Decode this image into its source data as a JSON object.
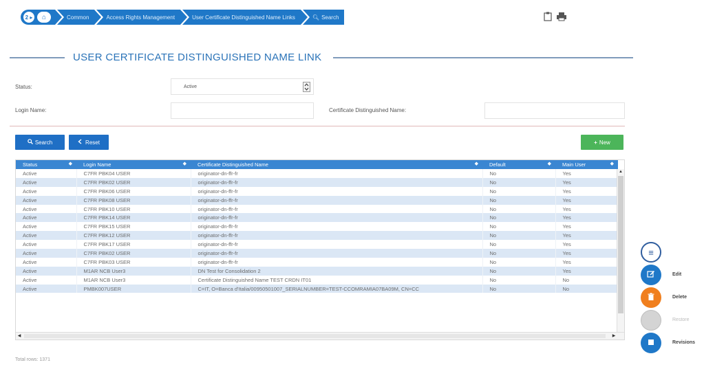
{
  "breadcrumb": {
    "nav_label": "2 ▸",
    "home_icon": "⌂",
    "items": [
      "Common",
      "Access Rights Management",
      "User Certificate Distinguished Name Links",
      "Search"
    ]
  },
  "page": {
    "title": "USER CERTIFICATE DISTINGUISHED NAME LINK"
  },
  "form": {
    "status_label": "Status:",
    "status_value": "Active",
    "login_label": "Login Name:",
    "login_value": "",
    "cert_label": "Certificate Distinguished Name:",
    "cert_value": ""
  },
  "buttons": {
    "search": "Search",
    "reset": "Reset",
    "new": "New"
  },
  "table": {
    "headers": [
      "Status",
      "Login Name",
      "Certificate Distinguished Name",
      "Default",
      "Main User"
    ],
    "rows": [
      [
        "Active",
        "C7FR PBK04 USER",
        "originator-dn-ffr-fr",
        "No",
        "Yes"
      ],
      [
        "Active",
        "C7FR PBK02 USER",
        "originator-dn-ffr-fr",
        "No",
        "Yes"
      ],
      [
        "Active",
        "C7FR PBK06 USER",
        "originator-dn-ffr-fr",
        "No",
        "Yes"
      ],
      [
        "Active",
        "C7FR PBK08 USER",
        "originator-dn-ffr-fr",
        "No",
        "Yes"
      ],
      [
        "Active",
        "C7FR PBK10 USER",
        "originator-dn-ffr-fr",
        "No",
        "Yes"
      ],
      [
        "Active",
        "C7FR PBK14 USER",
        "originator-dn-ffr-fr",
        "No",
        "Yes"
      ],
      [
        "Active",
        "C7FR PBK15 USER",
        "originator-dn-ffr-fr",
        "No",
        "Yes"
      ],
      [
        "Active",
        "C7FR PBK12 USER",
        "originator-dn-ffr-fr",
        "No",
        "Yes"
      ],
      [
        "Active",
        "C7FR PBK17 USER",
        "originator-dn-ffr-fr",
        "No",
        "Yes"
      ],
      [
        "Active",
        "C7FR PBK02 USER",
        "originator-dn-ffr-fr",
        "No",
        "Yes"
      ],
      [
        "Active",
        "C7FR PBK03 USER",
        "originator-dn-ffr-fr",
        "No",
        "Yes"
      ],
      [
        "Active",
        "M1AR NCB User3",
        "DN Test for Consolidation 2",
        "No",
        "Yes"
      ],
      [
        "Active",
        "M1AR NCB User3",
        "Certificate Distinguished Name TEST CRDN IT01",
        "No",
        "No"
      ],
      [
        "Active",
        "PMBK007USER",
        "C=IT, O=Banca d'Italia/00950501007_SERIALNUMBER=TEST-CCOMRAMIA07BA09M, CN=CC",
        "No",
        "No"
      ]
    ]
  },
  "footer": {
    "count": "Total rows: 1371"
  },
  "side_actions": {
    "menu_icon": "≡",
    "items": [
      {
        "label": "Edit",
        "color": "#1f78c8"
      },
      {
        "label": "Delete",
        "color": "#f07f1e"
      },
      {
        "label": "Restore",
        "color": "#c8c8c8"
      },
      {
        "label": "Revisions",
        "color": "#1f78c8"
      }
    ]
  },
  "colors": {
    "primary": "#1f78c8",
    "title": "#2a73b8",
    "new_button": "#4cb55a",
    "row_alt": "#dbe7f5"
  }
}
